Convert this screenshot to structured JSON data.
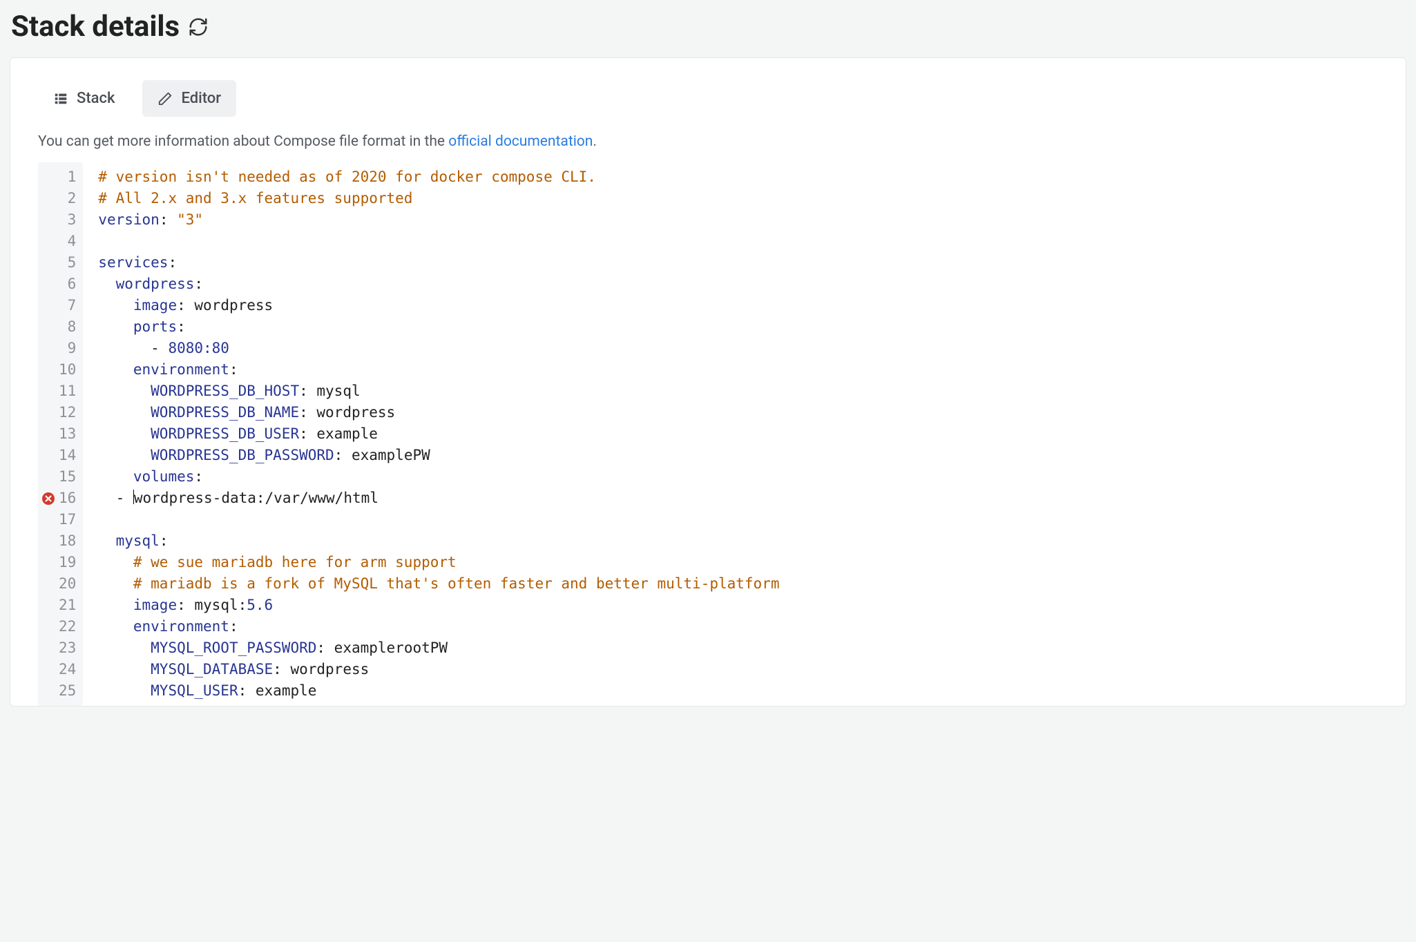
{
  "header": {
    "title": "Stack details",
    "refresh_icon": "refresh-icon"
  },
  "tabs": [
    {
      "id": "stack",
      "label": "Stack",
      "icon": "list-icon",
      "active": false
    },
    {
      "id": "editor",
      "label": "Editor",
      "icon": "pencil-icon",
      "active": true
    }
  ],
  "info": {
    "prefix": "You can get more information about Compose file format in the ",
    "link_text": "official documentation",
    "suffix": "."
  },
  "editor": {
    "first_line_number": 1,
    "lines": [
      {
        "n": 1,
        "marker": null,
        "tokens": [
          [
            "comment",
            "# version isn't needed as of 2020 for docker compose CLI."
          ]
        ]
      },
      {
        "n": 2,
        "marker": null,
        "tokens": [
          [
            "comment",
            "# All 2.x and 3.x features supported"
          ]
        ]
      },
      {
        "n": 3,
        "marker": null,
        "tokens": [
          [
            "key",
            "version"
          ],
          [
            "punc",
            ":"
          ],
          [
            "val",
            " "
          ],
          [
            "str",
            "\"3\""
          ]
        ]
      },
      {
        "n": 4,
        "marker": null,
        "tokens": []
      },
      {
        "n": 5,
        "marker": null,
        "tokens": [
          [
            "key",
            "services"
          ],
          [
            "punc",
            ":"
          ]
        ]
      },
      {
        "n": 6,
        "marker": null,
        "tokens": [
          [
            "val",
            "  "
          ],
          [
            "key",
            "wordpress"
          ],
          [
            "punc",
            ":"
          ]
        ]
      },
      {
        "n": 7,
        "marker": null,
        "tokens": [
          [
            "val",
            "    "
          ],
          [
            "key",
            "image"
          ],
          [
            "punc",
            ":"
          ],
          [
            "val",
            " wordpress"
          ]
        ]
      },
      {
        "n": 8,
        "marker": null,
        "tokens": [
          [
            "val",
            "    "
          ],
          [
            "key",
            "ports"
          ],
          [
            "punc",
            ":"
          ]
        ]
      },
      {
        "n": 9,
        "marker": null,
        "tokens": [
          [
            "val",
            "      "
          ],
          [
            "punc",
            "- "
          ],
          [
            "num",
            "8080:80"
          ]
        ]
      },
      {
        "n": 10,
        "marker": null,
        "tokens": [
          [
            "val",
            "    "
          ],
          [
            "key",
            "environment"
          ],
          [
            "punc",
            ":"
          ]
        ]
      },
      {
        "n": 11,
        "marker": null,
        "tokens": [
          [
            "val",
            "      "
          ],
          [
            "key",
            "WORDPRESS_DB_HOST"
          ],
          [
            "punc",
            ":"
          ],
          [
            "val",
            " mysql"
          ]
        ]
      },
      {
        "n": 12,
        "marker": null,
        "tokens": [
          [
            "val",
            "      "
          ],
          [
            "key",
            "WORDPRESS_DB_NAME"
          ],
          [
            "punc",
            ":"
          ],
          [
            "val",
            " wordpress"
          ]
        ]
      },
      {
        "n": 13,
        "marker": null,
        "tokens": [
          [
            "val",
            "      "
          ],
          [
            "key",
            "WORDPRESS_DB_USER"
          ],
          [
            "punc",
            ":"
          ],
          [
            "val",
            " example"
          ]
        ]
      },
      {
        "n": 14,
        "marker": null,
        "tokens": [
          [
            "val",
            "      "
          ],
          [
            "key",
            "WORDPRESS_DB_PASSWORD"
          ],
          [
            "punc",
            ":"
          ],
          [
            "val",
            " examplePW"
          ]
        ]
      },
      {
        "n": 15,
        "marker": null,
        "tokens": [
          [
            "val",
            "    "
          ],
          [
            "key",
            "volumes"
          ],
          [
            "punc",
            ":"
          ]
        ]
      },
      {
        "n": 16,
        "marker": "error",
        "cursor_after_token": 1,
        "tokens": [
          [
            "val",
            "  "
          ],
          [
            "punc",
            "- "
          ],
          [
            "val",
            "wordpress-data:/var/www/html"
          ]
        ]
      },
      {
        "n": 17,
        "marker": null,
        "tokens": []
      },
      {
        "n": 18,
        "marker": null,
        "tokens": [
          [
            "val",
            "  "
          ],
          [
            "key",
            "mysql"
          ],
          [
            "punc",
            ":"
          ]
        ]
      },
      {
        "n": 19,
        "marker": null,
        "tokens": [
          [
            "val",
            "    "
          ],
          [
            "comment",
            "# we sue mariadb here for arm support"
          ]
        ]
      },
      {
        "n": 20,
        "marker": null,
        "tokens": [
          [
            "val",
            "    "
          ],
          [
            "comment",
            "# mariadb is a fork of MySQL that's often faster and better multi-platform"
          ]
        ]
      },
      {
        "n": 21,
        "marker": null,
        "tokens": [
          [
            "val",
            "    "
          ],
          [
            "key",
            "image"
          ],
          [
            "punc",
            ":"
          ],
          [
            "val",
            " mysql:"
          ],
          [
            "num",
            "5.6"
          ]
        ]
      },
      {
        "n": 22,
        "marker": null,
        "tokens": [
          [
            "val",
            "    "
          ],
          [
            "key",
            "environment"
          ],
          [
            "punc",
            ":"
          ]
        ]
      },
      {
        "n": 23,
        "marker": null,
        "tokens": [
          [
            "val",
            "      "
          ],
          [
            "key",
            "MYSQL_ROOT_PASSWORD"
          ],
          [
            "punc",
            ":"
          ],
          [
            "val",
            " examplerootPW"
          ]
        ]
      },
      {
        "n": 24,
        "marker": null,
        "tokens": [
          [
            "val",
            "      "
          ],
          [
            "key",
            "MYSQL_DATABASE"
          ],
          [
            "punc",
            ":"
          ],
          [
            "val",
            " wordpress"
          ]
        ]
      },
      {
        "n": 25,
        "marker": null,
        "tokens": [
          [
            "val",
            "      "
          ],
          [
            "key",
            "MYSQL_USER"
          ],
          [
            "punc",
            ":"
          ],
          [
            "val",
            " example"
          ]
        ]
      }
    ]
  }
}
